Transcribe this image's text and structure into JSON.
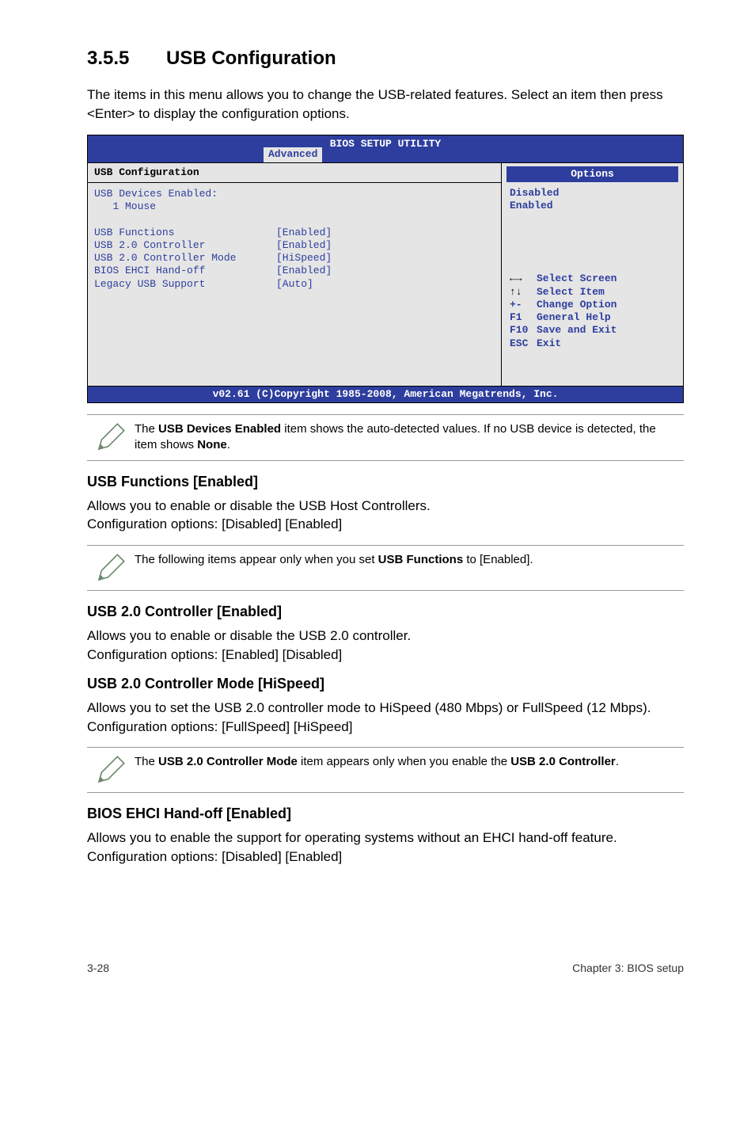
{
  "section": {
    "number": "3.5.5",
    "title": "USB Configuration"
  },
  "intro": "The items in this menu allows you to change the USB-related features. Select an item then press <Enter> to display the configuration options.",
  "bios": {
    "title": "BIOS SETUP UTILITY",
    "tab": "Advanced",
    "left_header": "USB Configuration",
    "devices_label": "USB Devices Enabled:",
    "devices_value": "1 Mouse",
    "rows": [
      {
        "label": "USB Functions",
        "value": "[Enabled]"
      },
      {
        "label": "USB 2.0 Controller",
        "value": "[Enabled]"
      },
      {
        "label": "USB 2.0 Controller Mode",
        "value": "[HiSpeed]"
      },
      {
        "label": "BIOS EHCI Hand-off",
        "value": "[Enabled]"
      },
      {
        "label": "Legacy USB Support",
        "value": "[Auto]"
      }
    ],
    "options_header": "Options",
    "options": [
      "Disabled",
      "Enabled"
    ],
    "nav": [
      {
        "sym": "←→",
        "label": "Select Screen"
      },
      {
        "sym": "↑↓",
        "label": "Select Item"
      },
      {
        "sym": "+-",
        "label": "Change Option"
      },
      {
        "sym": "F1",
        "label": "General Help"
      },
      {
        "sym": "F10",
        "label": "Save and Exit"
      },
      {
        "sym": "ESC",
        "label": "Exit"
      }
    ],
    "footer": "v02.61 (C)Copyright 1985-2008, American Megatrends, Inc."
  },
  "note1_a": "The ",
  "note1_b": "USB Devices Enabled",
  "note1_c": " item shows the auto-detected values. If no USB device is detected, the item shows ",
  "note1_d": "None",
  "note1_e": ".",
  "sub1": {
    "heading": "USB Functions [Enabled]",
    "l1": "Allows you to enable or disable the USB Host Controllers.",
    "l2": "Configuration options: [Disabled] [Enabled]"
  },
  "note2_a": "The following items appear only when you set ",
  "note2_b": "USB Functions",
  "note2_c": " to [Enabled].",
  "sub2": {
    "heading": "USB 2.0 Controller [Enabled]",
    "l1": "Allows you to enable or disable the USB 2.0 controller.",
    "l2": "Configuration options: [Enabled] [Disabled]"
  },
  "sub3": {
    "heading": "USB 2.0 Controller Mode [HiSpeed]",
    "l1": "Allows you to set the USB 2.0 controller mode to HiSpeed (480 Mbps) or FullSpeed (12 Mbps).",
    "l2": "Configuration options: [FullSpeed] [HiSpeed]"
  },
  "note3_a": "The ",
  "note3_b": "USB 2.0 Controller Mode",
  "note3_c": " item appears only when you enable the ",
  "note3_d": "USB 2.0 Controller",
  "note3_e": ".",
  "sub4": {
    "heading": "BIOS EHCI Hand-off [Enabled]",
    "l1": "Allows you to enable the support for operating systems without an EHCI hand-off feature.",
    "l2": "Configuration options: [Disabled] [Enabled]"
  },
  "footer": {
    "left": "3-28",
    "right": "Chapter 3: BIOS setup"
  }
}
